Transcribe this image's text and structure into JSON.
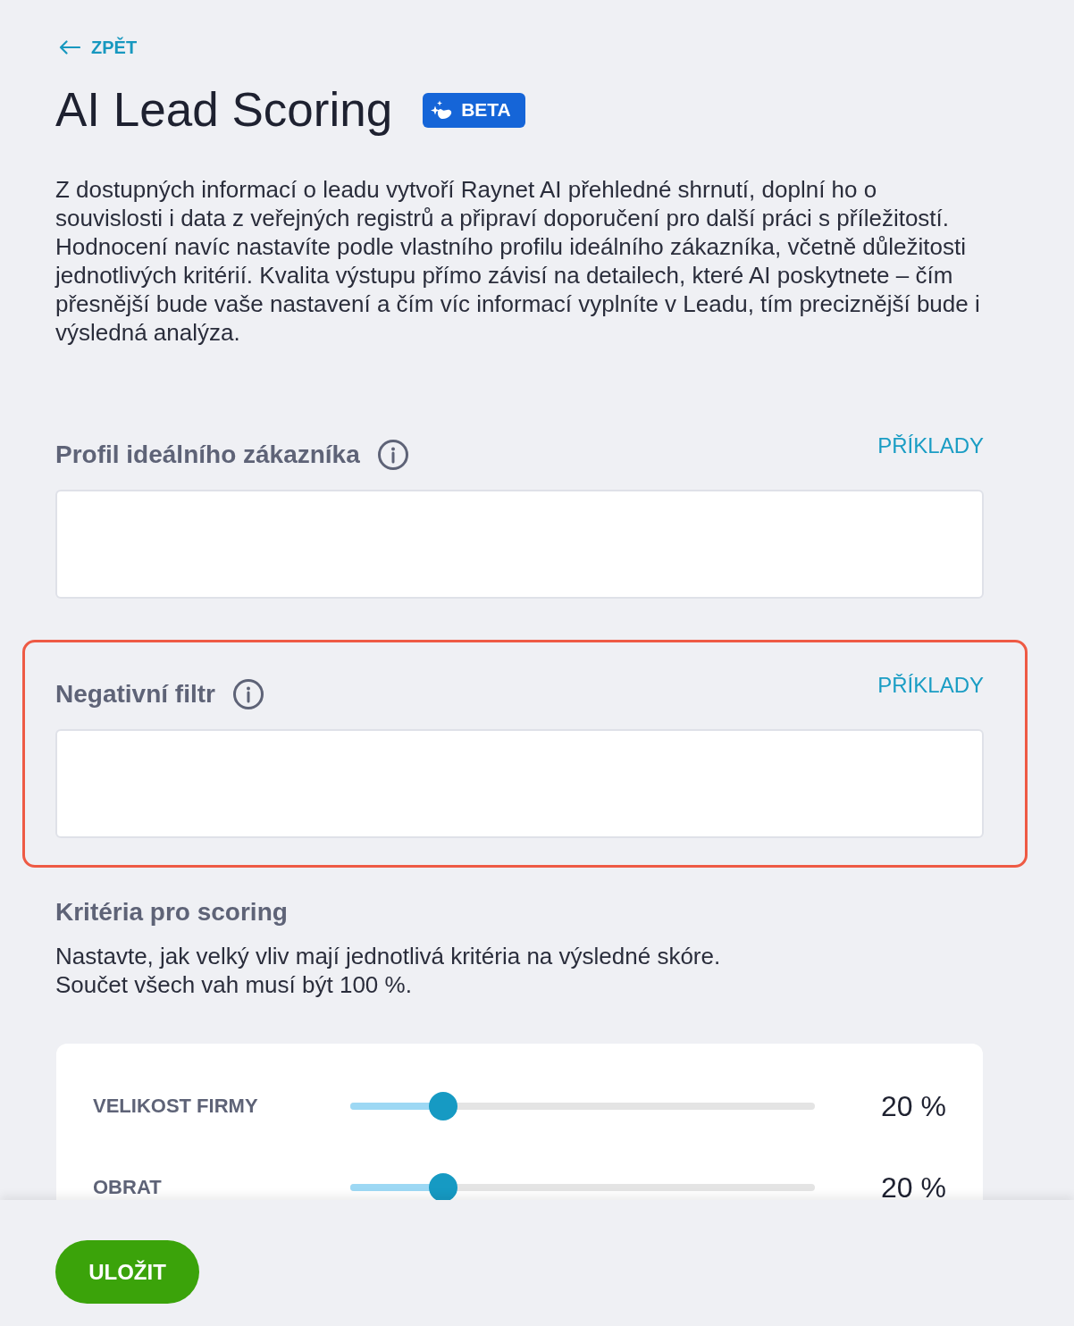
{
  "back_link": {
    "label": "ZPĚT"
  },
  "header": {
    "title": "AI Lead Scoring",
    "badge": "BETA"
  },
  "description": "Z dostupných informací o leadu vytvoří Raynet AI přehledné shrnutí, doplní ho o souvislosti i data z veřejných registrů a připraví doporučení pro další práci s příležitostí. Hodnocení navíc nastavíte podle vlastního profilu ideálního zákazníka, včetně důležitosti jednotlivých kritérií. Kvalita výstupu přímo závisí na detailech, které AI poskytnete – čím přesnější bude vaše nastavení a čím víc informací vyplníte v Leadu, tím preciznější bude i výsledná analýza.",
  "sections": [
    {
      "title": "Profil ideálního zákazníka",
      "link": "PŘÍKLADY",
      "highlighted": false
    },
    {
      "title": "Negativní filtr",
      "link": "PŘÍKLADY",
      "highlighted": true
    }
  ],
  "criteria": {
    "title": "Kritéria pro scoring",
    "hint": [
      "Nastavte, jak velký vliv mají jednotlivá kritéria na výsledné skóre.",
      "Součet všech vah musí být 100 %."
    ],
    "rows": [
      {
        "label": "VELIKOST FIRMY",
        "level": 0.2,
        "reading": "20 %"
      },
      {
        "label": "OBRAT",
        "level": 0.2,
        "reading": "20 %"
      }
    ]
  },
  "footer": {
    "save_button": "ULOŽIT"
  }
}
